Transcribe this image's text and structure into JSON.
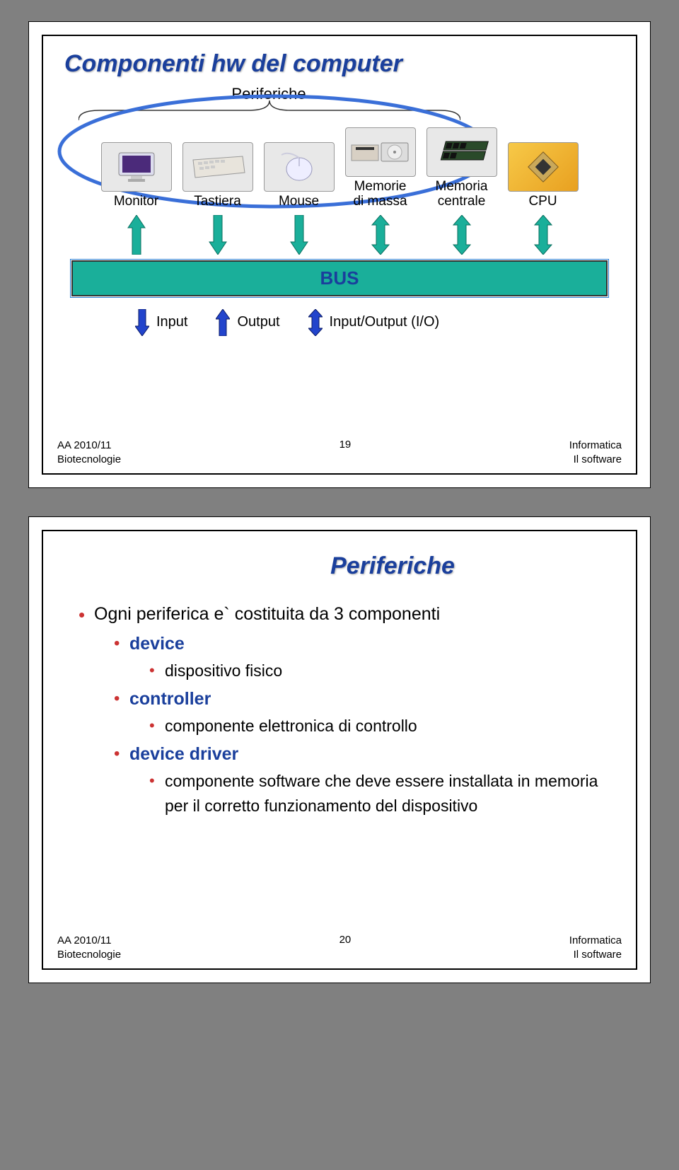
{
  "slide1": {
    "title": "Componenti hw del computer",
    "periferiche_label": "Periferiche",
    "hw_items": [
      {
        "label": "Monitor",
        "arrow": "up",
        "color": "#1aaf9a"
      },
      {
        "label": "Tastiera",
        "arrow": "down",
        "color": "#1aaf9a"
      },
      {
        "label": "Mouse",
        "arrow": "down",
        "color": "#1aaf9a"
      },
      {
        "label": "Memorie\ndi massa",
        "arrow": "double",
        "color": "#1aaf9a"
      },
      {
        "label": "Memoria\ncentrale",
        "arrow": "double",
        "color": "#1aaf9a"
      },
      {
        "label": "CPU",
        "arrow": "double",
        "color": "#1aaf9a"
      }
    ],
    "bus_label": "BUS",
    "legend": {
      "input": "Input",
      "output": "Output",
      "io": "Input/Output (I/O)"
    },
    "footer": {
      "year": "AA 2010/11",
      "dept": "Biotecnologie",
      "page": "19",
      "course": "Informatica",
      "topic": "Il software"
    }
  },
  "slide2": {
    "title": "Periferiche",
    "intro": "Ogni periferica e` costituita da 3 componenti",
    "items": [
      {
        "term": "device",
        "desc": "dispositivo fisico"
      },
      {
        "term": "controller",
        "desc": "componente elettronica di controllo"
      },
      {
        "term": "device driver",
        "desc": "componente software che deve essere installata in memoria per il corretto funzionamento del dispositivo"
      }
    ],
    "footer": {
      "year": "AA 2010/11",
      "dept": "Biotecnologie",
      "page": "20",
      "course": "Informatica",
      "topic": "Il software"
    }
  }
}
